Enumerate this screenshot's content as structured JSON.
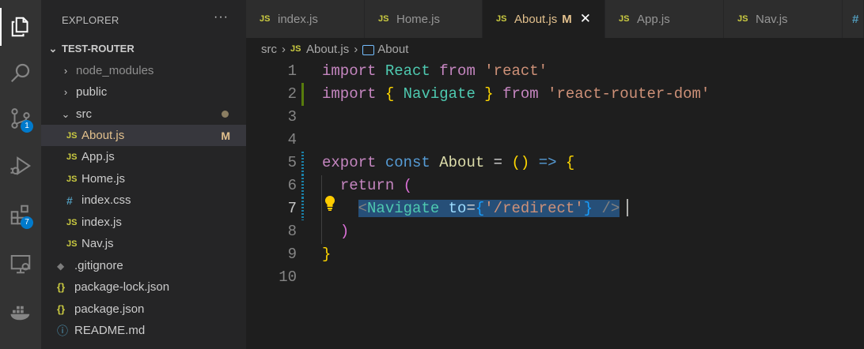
{
  "activity_bar": {
    "items": [
      {
        "name": "explorer-icon"
      },
      {
        "name": "search-icon"
      },
      {
        "name": "source-control-icon",
        "badge": "1"
      },
      {
        "name": "run-debug-icon"
      },
      {
        "name": "extensions-icon",
        "badge": "7"
      },
      {
        "name": "remote-explorer-icon"
      },
      {
        "name": "docker-icon"
      }
    ]
  },
  "sidebar": {
    "title": "EXPLORER",
    "more": "···",
    "project": "TEST-ROUTER",
    "tree": [
      {
        "label": "node_modules",
        "type": "folder"
      },
      {
        "label": "public",
        "type": "folder"
      },
      {
        "label": "src",
        "type": "folder-open"
      },
      {
        "label": "About.js",
        "type": "js",
        "flag": "M",
        "icon": "JS"
      },
      {
        "label": "App.js",
        "type": "js",
        "icon": "JS"
      },
      {
        "label": "Home.js",
        "type": "js",
        "icon": "JS"
      },
      {
        "label": "index.css",
        "type": "css",
        "icon": "#"
      },
      {
        "label": "index.js",
        "type": "js",
        "icon": "JS"
      },
      {
        "label": "Nav.js",
        "type": "js",
        "icon": "JS"
      },
      {
        "label": ".gitignore",
        "type": "git",
        "icon": "◆"
      },
      {
        "label": "package-lock.json",
        "type": "json",
        "icon": "{}"
      },
      {
        "label": "package.json",
        "type": "json",
        "icon": "{}"
      },
      {
        "label": "README.md",
        "type": "info",
        "icon": "ⓘ"
      }
    ]
  },
  "tabs": [
    {
      "label": "index.js",
      "icon": "JS"
    },
    {
      "label": "Home.js",
      "icon": "JS"
    },
    {
      "label": "About.js",
      "icon": "JS",
      "flag": "M",
      "close": "✕",
      "active": true
    },
    {
      "label": "App.js",
      "icon": "JS"
    },
    {
      "label": "Nav.js",
      "icon": "JS"
    },
    {
      "label": "#",
      "icon": ""
    }
  ],
  "breadcrumb": {
    "folder": "src",
    "sep": "›",
    "file_icon": "JS",
    "file": "About.js",
    "symbol": "About"
  },
  "editor": {
    "line_numbers": [
      "1",
      "2",
      "3",
      "4",
      "5",
      "6",
      "7",
      "8",
      "9",
      "10"
    ],
    "code": {
      "l1_import": "import",
      "l1_name": "React",
      "l1_from": "from",
      "l1_str": "'react'",
      "l2_import": "import",
      "l2_open": "{",
      "l2_name": "Navigate",
      "l2_close": "}",
      "l2_from": "from",
      "l2_str": "'react-router-dom'",
      "l5_export": "export",
      "l5_const": "const",
      "l5_name": "About",
      "l5_eq": "=",
      "l5_parens": "()",
      "l5_arrow": "=>",
      "l5_brace": "{",
      "l6_return": "return",
      "l6_paren": "(",
      "l7_lt": "<",
      "l7_tag": "Navigate",
      "l7_attr": "to",
      "l7_eq": "=",
      "l7_bo": "{",
      "l7_str": "'/redirect'",
      "l7_bc": "}",
      "l7_end": "/>",
      "l8_paren": ")",
      "l9_brace": "}"
    }
  },
  "colors": {
    "activity_bar": "#333333",
    "sidebar": "#252526",
    "editor_bg": "#1e1e1e",
    "badge": "#007acc",
    "modified": "#e2c08d",
    "selection": "#264f78"
  }
}
